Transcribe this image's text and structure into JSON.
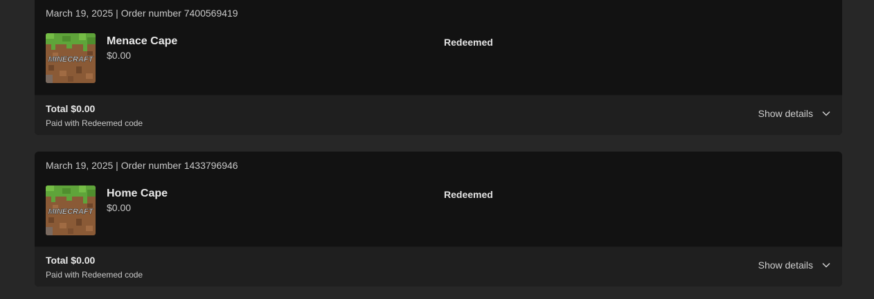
{
  "orders": [
    {
      "meta": "March 19, 2025 | Order number 7400569419",
      "product": {
        "name": "Menace Cape",
        "price": "$0.00",
        "image_label": "MINECRAFT",
        "icon": "minecraft-grass-block-icon"
      },
      "status": "Redeemed",
      "total": "Total $0.00",
      "payment": "Paid with Redeemed code",
      "details_label": "Show details"
    },
    {
      "meta": "March 19, 2025 | Order number 1433796946",
      "product": {
        "name": "Home Cape",
        "price": "$0.00",
        "image_label": "MINECRAFT",
        "icon": "minecraft-grass-block-icon"
      },
      "status": "Redeemed",
      "total": "Total $0.00",
      "payment": "Paid with Redeemed code",
      "details_label": "Show details"
    }
  ],
  "colors": {
    "page_background": "#272727",
    "card_background": "#121212",
    "footer_background": "#1f1f1f",
    "text_primary": "#e8e8e8",
    "text_secondary": "#c8c8c8",
    "grass_green": "#5fa43a",
    "dirt_brown": "#8a5a36"
  }
}
